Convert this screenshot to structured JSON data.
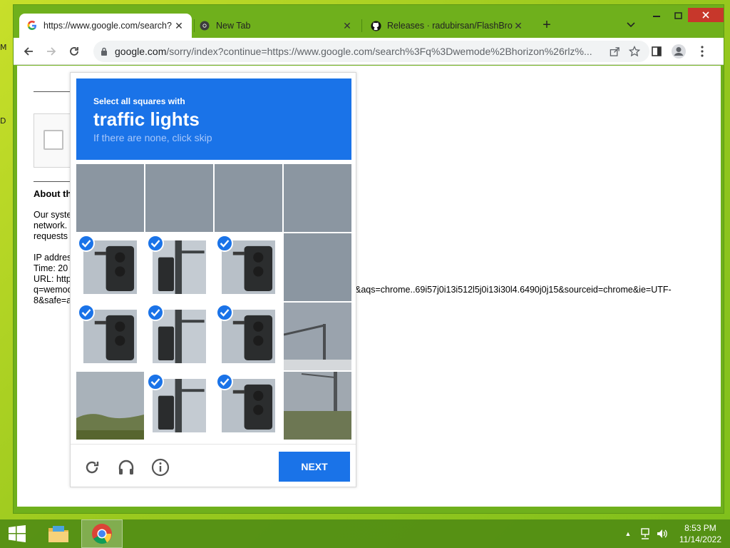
{
  "desktop": {
    "labels": [
      "M",
      "D"
    ]
  },
  "browser": {
    "tabs": [
      {
        "title": "https://www.google.com/search?",
        "icon": "google-icon",
        "active": true
      },
      {
        "title": "New Tab",
        "icon": "chrome-icon",
        "active": false
      },
      {
        "title": "Releases · radubirsan/FlashBrows",
        "icon": "github-icon",
        "active": false
      }
    ],
    "new_tab_label": "+",
    "url_host": "google.com",
    "url_rest": "/sorry/index?continue=https://www.google.com/search%3Fq%3Dwemode%2Bhorizon%26rlz%..."
  },
  "page": {
    "about_heading": "About th",
    "body_lines": [
      "Our syste",
      "network.",
      "requests",
      "",
      "IP addres",
      "Time: 20",
      "URL: http",
      "q=wemod",
      "8&safe=a"
    ],
    "url_tail": "&aqs=chrome..69i57j0i13i512l5j0i13i30l4.6490j0j15&sourceid=chrome&ie=UTF-"
  },
  "captcha": {
    "line1": "Select all squares with",
    "object": "traffic lights",
    "hint": "If there are none, click skip",
    "next_label": "NEXT",
    "accent": "#1a73e8",
    "tiles": [
      {
        "row": 0,
        "col": 0,
        "selected": false,
        "scene": "sky"
      },
      {
        "row": 0,
        "col": 1,
        "selected": false,
        "scene": "sky"
      },
      {
        "row": 0,
        "col": 2,
        "selected": false,
        "scene": "sky"
      },
      {
        "row": 0,
        "col": 3,
        "selected": false,
        "scene": "sky"
      },
      {
        "row": 1,
        "col": 0,
        "selected": true,
        "scene": "signal"
      },
      {
        "row": 1,
        "col": 1,
        "selected": true,
        "scene": "pole"
      },
      {
        "row": 1,
        "col": 2,
        "selected": true,
        "scene": "signal"
      },
      {
        "row": 1,
        "col": 3,
        "selected": false,
        "scene": "sky"
      },
      {
        "row": 2,
        "col": 0,
        "selected": true,
        "scene": "signal"
      },
      {
        "row": 2,
        "col": 1,
        "selected": true,
        "scene": "pole"
      },
      {
        "row": 2,
        "col": 2,
        "selected": true,
        "scene": "signal"
      },
      {
        "row": 2,
        "col": 3,
        "selected": false,
        "scene": "streetlight"
      },
      {
        "row": 3,
        "col": 0,
        "selected": false,
        "scene": "trees"
      },
      {
        "row": 3,
        "col": 1,
        "selected": true,
        "scene": "pole"
      },
      {
        "row": 3,
        "col": 2,
        "selected": true,
        "scene": "signal"
      },
      {
        "row": 3,
        "col": 3,
        "selected": false,
        "scene": "streetpole"
      }
    ]
  },
  "taskbar": {
    "time": "8:53 PM",
    "date": "11/14/2022"
  }
}
